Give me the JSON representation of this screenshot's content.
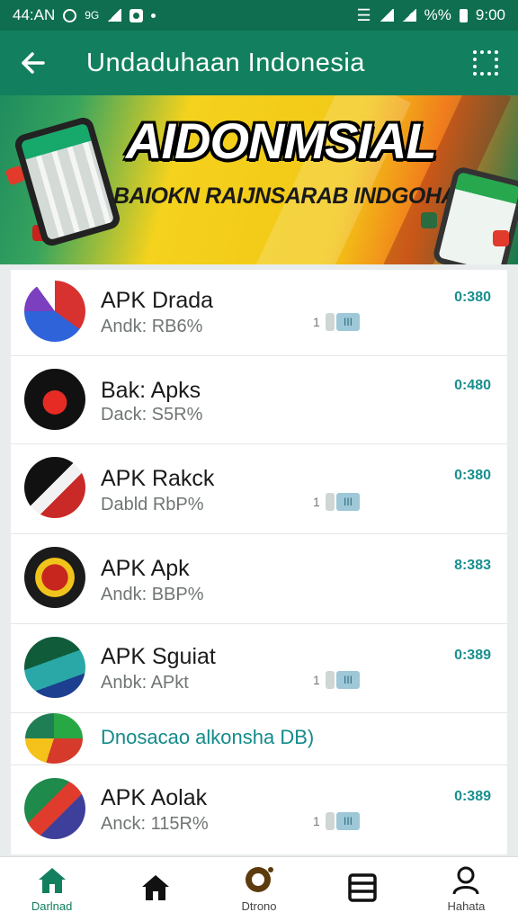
{
  "status_bar": {
    "time_left": "44:AN",
    "carrier": "9G",
    "battery_text": "%%",
    "time_right": "9:00"
  },
  "app_bar": {
    "title": "Undaduhaan  Indonesia"
  },
  "banner": {
    "headline": "AIDONMSIAL",
    "subtitle": "BAIOKN RAIJNSARAB  INDGOHAI"
  },
  "apps": [
    {
      "name": "APK Drada",
      "sub": "Andk: RB6%",
      "size": "0:380",
      "dl_count": "1",
      "dl_badge": "III"
    },
    {
      "name": "Bak: Apks",
      "sub": "Dack: S5R%",
      "size": "0:480"
    },
    {
      "name": "APK Rakck",
      "sub": "Dabld RbP%",
      "size": "0:380",
      "dl_count": "1",
      "dl_badge": "III"
    },
    {
      "name": "APK  Apk",
      "sub": "Andk: BBP%",
      "size": "8:383"
    },
    {
      "name": "APK Sguiat",
      "sub": "Anbk: APkt",
      "size": "0:389",
      "dl_count": "1",
      "dl_badge": "III"
    },
    {
      "name": "APK  Aolak",
      "sub": "Anck: 115R%",
      "size": "0:389",
      "dl_count": "1",
      "dl_badge": "III"
    }
  ],
  "promo": {
    "text": "Dnosacao alkonsha DB)"
  },
  "bottom_nav": [
    {
      "label": "Darlnad",
      "icon": "home-icon",
      "active": true
    },
    {
      "label": "",
      "icon": "store-icon",
      "active": false
    },
    {
      "label": "Dtrono",
      "icon": "chat-icon",
      "active": false
    },
    {
      "label": "",
      "icon": "list-icon",
      "active": false
    },
    {
      "label": "Hahata",
      "icon": "profile-icon",
      "active": false
    }
  ],
  "colors": {
    "primary": "#12805e",
    "status_bar": "#0f6e4f",
    "accent_text": "#1a8f8f"
  }
}
